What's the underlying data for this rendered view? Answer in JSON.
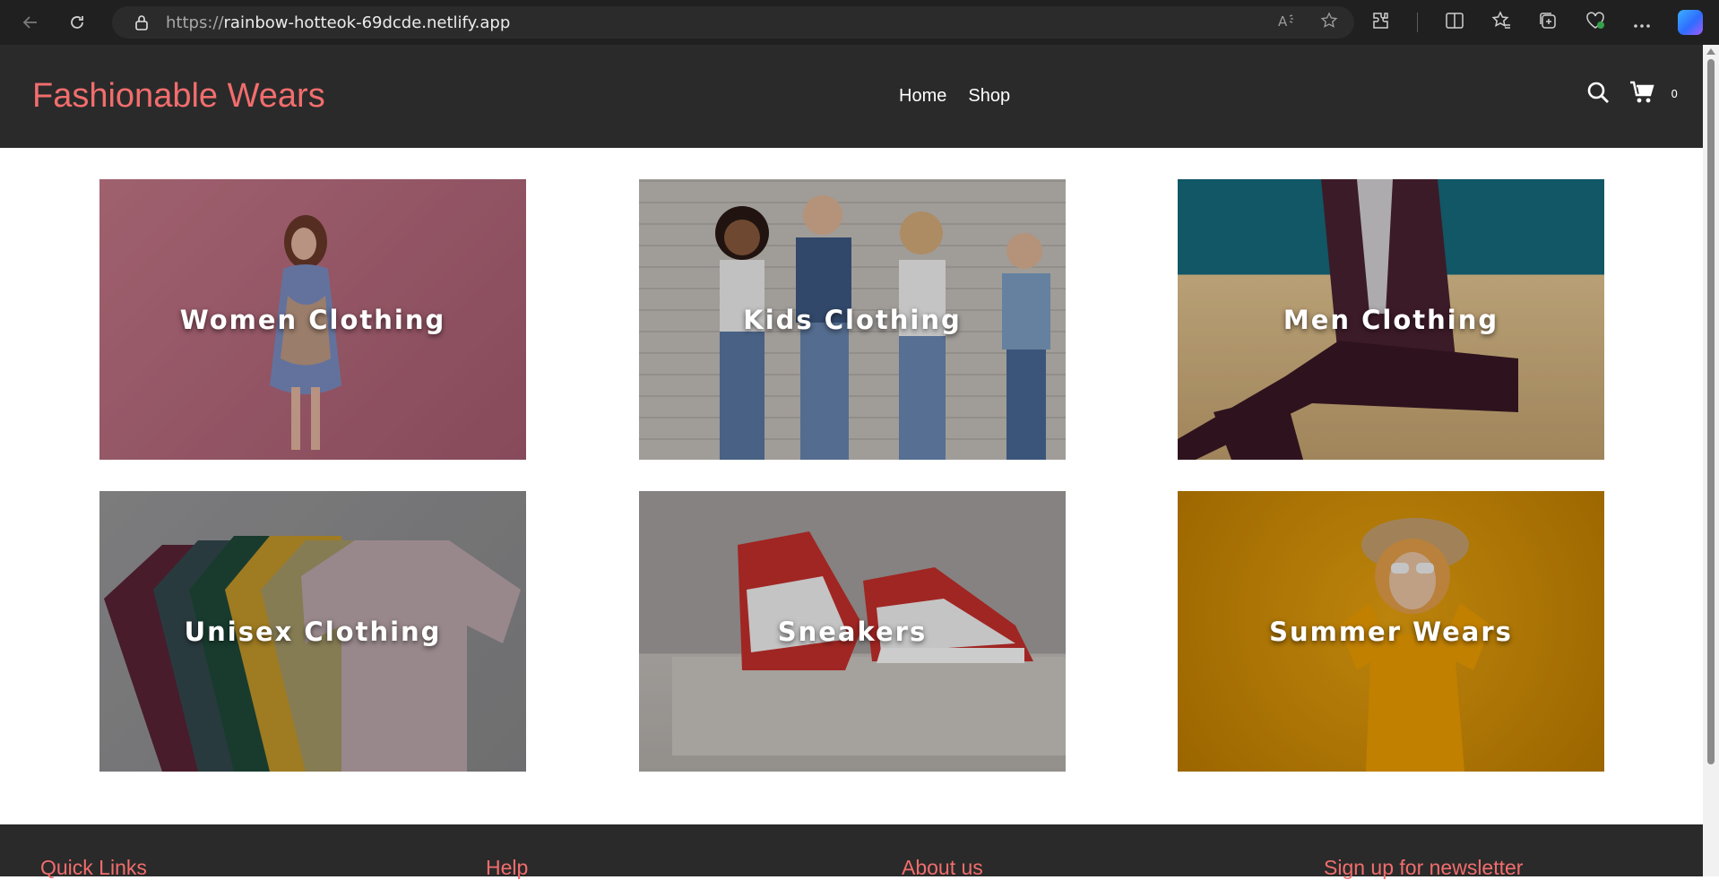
{
  "browser": {
    "url_protocol": "https://",
    "url_host": "rainbow-hotteok-69dcde.netlify.app"
  },
  "site": {
    "logo": "Fashionable Wears",
    "nav": [
      "Home",
      "Shop"
    ],
    "cart_count": "0",
    "accent_color": "#f26d6d",
    "header_bg": "#2a2a2a"
  },
  "categories": [
    {
      "label": "Women Clothing"
    },
    {
      "label": "Kids Clothing"
    },
    {
      "label": "Men Clothing"
    },
    {
      "label": "Unisex Clothing"
    },
    {
      "label": "Sneakers"
    },
    {
      "label": "Summer Wears"
    }
  ],
  "footer": {
    "columns": [
      "Quick Links",
      "Help",
      "About us",
      "Sign up for newsletter"
    ]
  }
}
